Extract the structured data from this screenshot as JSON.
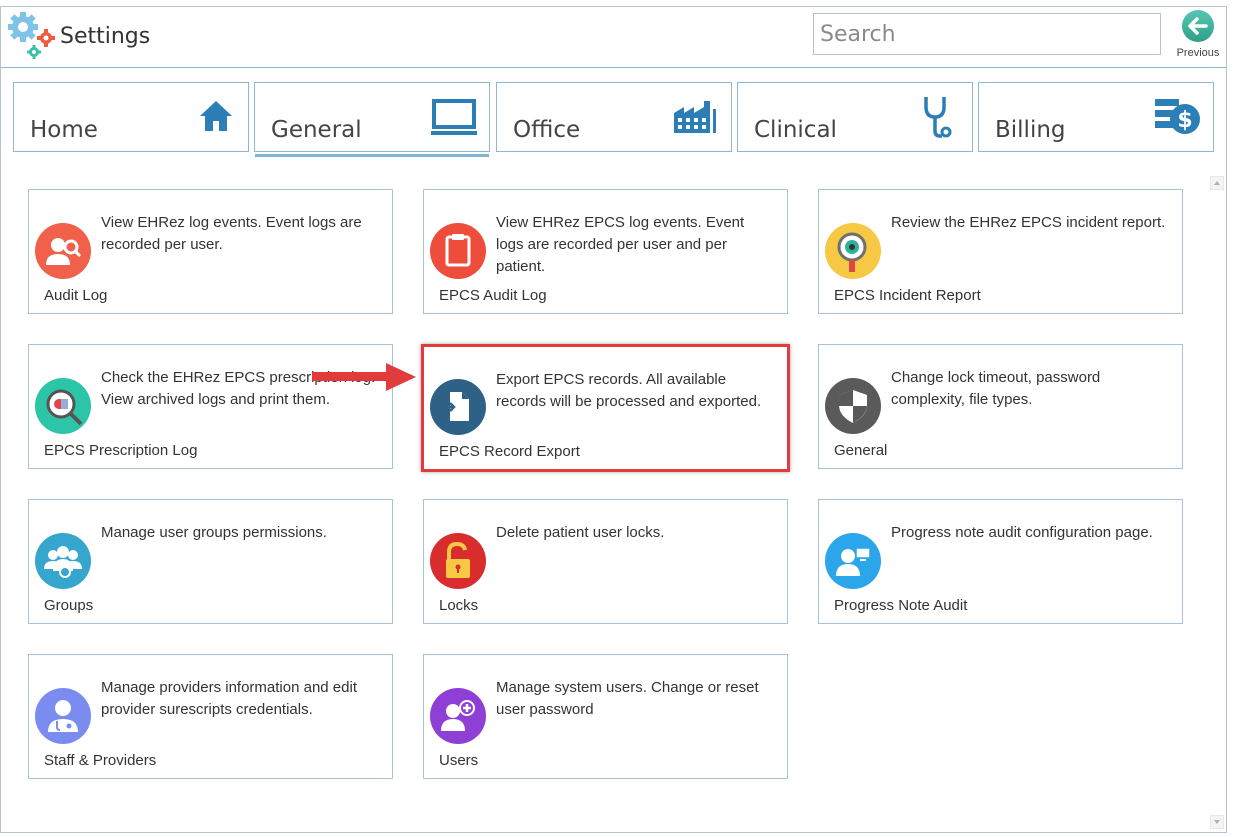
{
  "header": {
    "title": "Settings",
    "search_placeholder": "Search",
    "previous_label": "Previous"
  },
  "tabs": [
    {
      "label": "Home",
      "icon": "home-icon"
    },
    {
      "label": "General",
      "icon": "monitor-icon",
      "active": true
    },
    {
      "label": "Office",
      "icon": "building-icon"
    },
    {
      "label": "Clinical",
      "icon": "stethoscope-icon"
    },
    {
      "label": "Billing",
      "icon": "billing-icon"
    }
  ],
  "cards": [
    {
      "title": "Audit Log",
      "desc": "View EHRez log events. Event logs are recorded per user.",
      "icon": "audit-log-icon",
      "color": "#f0604a"
    },
    {
      "title": "EPCS Audit Log",
      "desc": "View EHRez EPCS log events. Event logs are recorded per user and per patient.",
      "icon": "clipboard-icon",
      "color": "#ef4d3b"
    },
    {
      "title": "EPCS Incident Report",
      "desc": "Review the EHRez EPCS incident report.",
      "icon": "magnifier-eye-icon",
      "color": "#f6c844"
    },
    {
      "title": "EPCS Prescription Log",
      "desc": "Check the EHRez EPCS prescription log. View archived logs and print them.",
      "icon": "pill-magnifier-icon",
      "color": "#2cc5a8"
    },
    {
      "title": "EPCS Record Export",
      "desc": "Export EPCS records. All available records will be processed and exported.",
      "icon": "document-export-icon",
      "color": "#2d6185",
      "highlight": true
    },
    {
      "title": "General",
      "desc": "Change lock timeout, password complexity, file types.",
      "icon": "shield-icon",
      "color": "#5a5a5a"
    },
    {
      "title": "Groups",
      "desc": "Manage user groups permissions.",
      "icon": "groups-icon",
      "color": "#36a6ce"
    },
    {
      "title": "Locks",
      "desc": "Delete patient user locks.",
      "icon": "lock-icon",
      "color": "#d92c2c"
    },
    {
      "title": "Progress Note Audit",
      "desc": "Progress note audit configuration page.",
      "icon": "user-monitor-icon",
      "color": "#2ba6ea"
    },
    {
      "title": "Staff & Providers",
      "desc": "Manage providers information and edit provider surescripts credentials.",
      "icon": "doctor-icon",
      "color": "#7a8cf0"
    },
    {
      "title": "Users",
      "desc": "Manage system users. Change or reset user password",
      "icon": "add-user-icon",
      "color": "#8d3fd6"
    }
  ],
  "colors": {
    "accent": "#7fb4d8",
    "tab_icon": "#2b7fb6",
    "highlight": "#e23b3b"
  }
}
